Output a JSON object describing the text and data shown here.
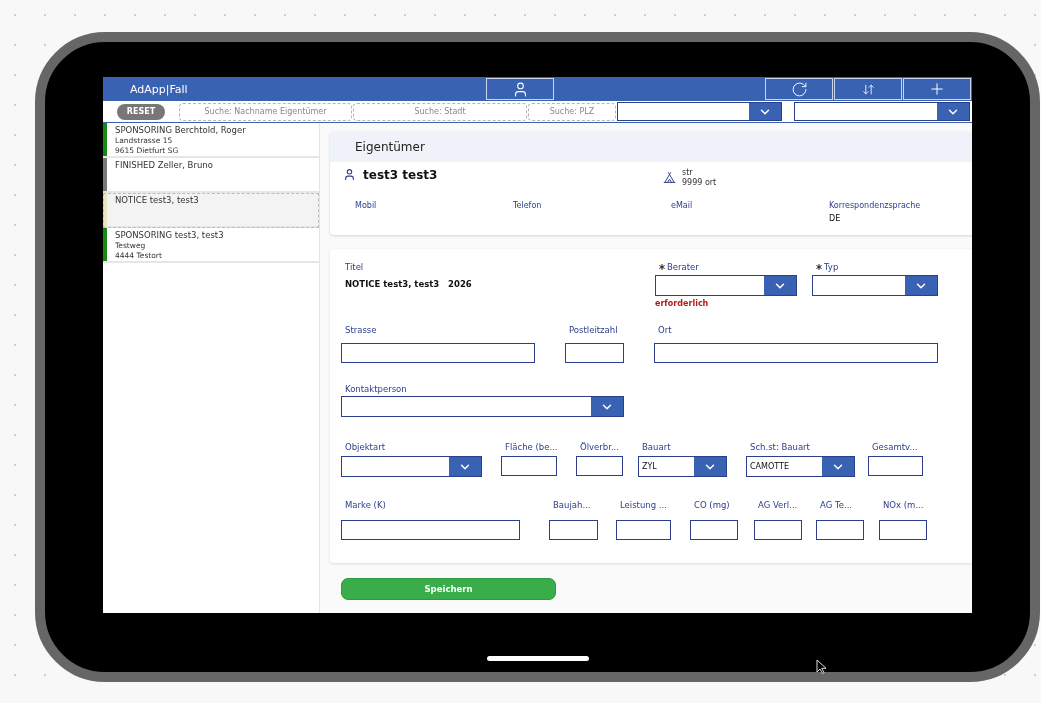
{
  "header": {
    "title": "AdApp|Fall"
  },
  "filters": {
    "reset": "RESET",
    "searches": [
      {
        "placeholder": "Suche: Nachname Eigentümer"
      },
      {
        "placeholder": "Suche: Stadt"
      },
      {
        "placeholder": "Suche: PLZ"
      }
    ]
  },
  "cases": [
    {
      "title": "SPONSORING Berchtold, Roger",
      "lines": [
        "Landstrasse 15",
        "9615 Dietfurt SG"
      ],
      "color": "#138a13",
      "selected": false
    },
    {
      "title": "FINISHED Zeller, Bruno",
      "color": "#7a7a7a",
      "selected": false
    },
    {
      "title": "NOTICE test3, test3",
      "color": "#ece6bf",
      "selected": true
    },
    {
      "title": "SPONSORING test3, test3",
      "lines": [
        "Testweg",
        "4444 Testort"
      ],
      "color": "#138a13",
      "selected": false
    }
  ],
  "owner": {
    "heading": "Eigentümer",
    "name": "test3 test3",
    "address": [
      "str",
      "9999 ort"
    ],
    "contacts": [
      {
        "label": "Mobil"
      },
      {
        "label": "Telefon"
      },
      {
        "label": "eMail"
      },
      {
        "label": "Korrespondenzsprache",
        "value": "DE"
      }
    ]
  },
  "form": {
    "fields": [
      {
        "kind": "text",
        "label": "Titel",
        "value": "NOTICE test3, test3   2026"
      },
      {
        "kind": "dropdown",
        "label": "Berater",
        "required": true,
        "error": "erforderlich"
      },
      {
        "kind": "dropdown",
        "label": "Typ",
        "required": true
      },
      {
        "kind": "input",
        "label": "Strasse"
      },
      {
        "kind": "input",
        "label": "Postleitzahl"
      },
      {
        "kind": "input",
        "label": "Ort"
      },
      {
        "kind": "dropdown",
        "label": "Kontaktperson"
      },
      {
        "kind": "dropdown",
        "label": "Objektart"
      },
      {
        "kind": "input",
        "label": "Fläche (be..."
      },
      {
        "kind": "input",
        "label": "Ölverbr..."
      },
      {
        "kind": "dropdown",
        "label": "Bauart",
        "value": "ZYL"
      },
      {
        "kind": "dropdown",
        "label": "Sch.st: Bauart",
        "value": "CAMOTTE"
      },
      {
        "kind": "input",
        "label": "Gesamtv..."
      },
      {
        "kind": "input",
        "label": "Marke (K)"
      },
      {
        "kind": "input",
        "label": "Baujah..."
      },
      {
        "kind": "input",
        "label": "Leistung ..."
      },
      {
        "kind": "input",
        "label": "CO (mg)"
      },
      {
        "kind": "input",
        "label": "AG Verl..."
      },
      {
        "kind": "input",
        "label": "AG Te..."
      },
      {
        "kind": "input",
        "label": "NOx (m..."
      }
    ],
    "save": "Speichern"
  }
}
